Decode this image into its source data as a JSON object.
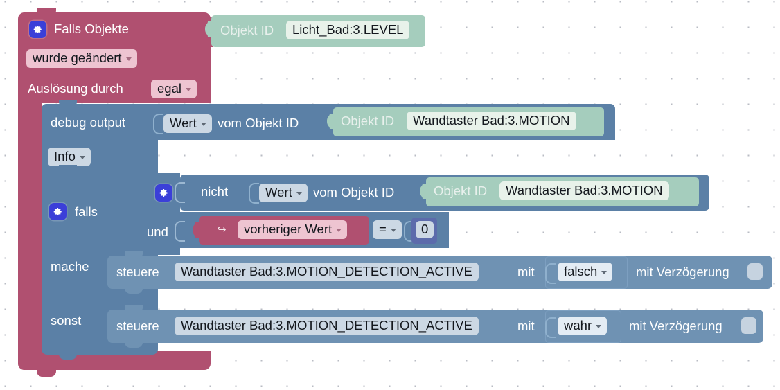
{
  "workspace": {
    "kind": "blockly-workspace",
    "grid": "dotted",
    "colors": {
      "trigger_block": "#b05070",
      "statement_block": "#5b80a6",
      "value_block": "#a5cdbd",
      "number_block": "#5c6bab",
      "compare_block": "#b05070",
      "gear_icon": "#3b3fd8",
      "canvas": "#ffffff"
    }
  },
  "trigger": {
    "icon": "gear-icon",
    "title": "Falls Objekte",
    "condition_dropdown": "wurde geändert",
    "source_label": "Auslösung durch",
    "source_dropdown": "egal",
    "object_id": {
      "label": "Objekt ID",
      "value": "Licht_Bad:3.LEVEL"
    }
  },
  "debug": {
    "label": "debug output",
    "value_dropdown": "Wert",
    "from_label": "vom Objekt ID",
    "object_id": {
      "label": "Objekt ID",
      "value": "Wandtaster Bad:3.MOTION"
    },
    "severity_dropdown": "Info"
  },
  "conditional": {
    "icon": "gear-icon",
    "if_label": "falls",
    "do_label": "mache",
    "else_label": "sonst",
    "and_label": "und",
    "condition_a": {
      "icon": "gear-icon",
      "not_label": "nicht",
      "value_dropdown": "Wert",
      "from_label": "vom Objekt ID",
      "object_id": {
        "label": "Objekt ID",
        "value": "Wandtaster Bad:3.MOTION"
      }
    },
    "condition_b": {
      "arrow_icon": "return-arrow-icon",
      "variable_dropdown": "vorheriger Wert",
      "operator_dropdown": "=",
      "number": "0"
    },
    "do_action": {
      "verb": "steuere",
      "target": "Wandtaster Bad:3.MOTION_DETECTION_ACTIVE",
      "with_label": "mit",
      "value_dropdown": "falsch",
      "delay_label": "mit Verzögerung",
      "delay_checkbox": "unchecked"
    },
    "else_action": {
      "verb": "steuere",
      "target": "Wandtaster Bad:3.MOTION_DETECTION_ACTIVE",
      "with_label": "mit",
      "value_dropdown": "wahr",
      "delay_label": "mit Verzögerung",
      "delay_checkbox": "unchecked"
    }
  }
}
